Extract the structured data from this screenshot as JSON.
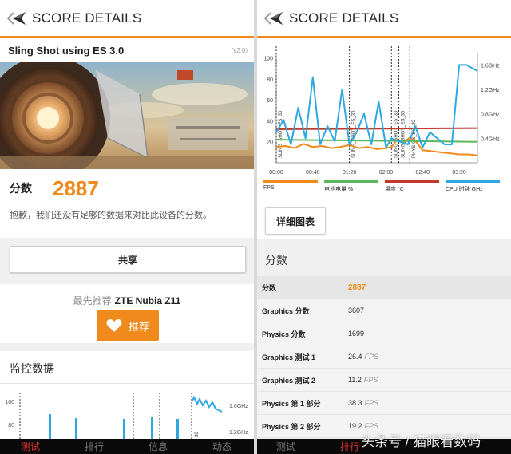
{
  "left_pane": {
    "header": {
      "title": "SCORE DETAILS"
    },
    "test": {
      "name": "Sling Shot using ES 3.0",
      "version": "(v2.0)"
    },
    "score": {
      "label": "分数",
      "value": "2887"
    },
    "notice": "抱歉，我们还没有足够的数据来对比此设备的分数。",
    "share_label": "共享",
    "recommend": {
      "prefix": "最先推荐",
      "device": "ZTE Nubia Z11",
      "button": "推荐"
    },
    "monitor": {
      "title": "监控数据",
      "y_ticks": [
        "100",
        "80"
      ],
      "right_ticks": [
        "1.6GHz",
        "1.2GHz"
      ],
      "marker_label": "30"
    }
  },
  "right_pane": {
    "header": {
      "title": "SCORE DETAILS"
    },
    "chart": {
      "legend": [
        {
          "label": "FPS",
          "color": "#f08a1c"
        },
        {
          "label": "电池电量 %",
          "color": "#5cb85c"
        },
        {
          "label": "温度 °C",
          "color": "#c0392b"
        },
        {
          "label": "CPU 时钟 GHz",
          "color": "#2ea8e0"
        }
      ]
    },
    "detail_button": "详细图表",
    "section_title": "分数",
    "table": [
      {
        "name": "分数",
        "value": "2887",
        "unit": ""
      },
      {
        "name": "Graphics 分数",
        "value": "3607",
        "unit": ""
      },
      {
        "name": "Physics 分数",
        "value": "1699",
        "unit": ""
      },
      {
        "name": "Graphics 测试 1",
        "value": "26.4",
        "unit": "FPS"
      },
      {
        "name": "Graphics 测试 2",
        "value": "11.2",
        "unit": "FPS"
      },
      {
        "name": "Physics 第 1 部分",
        "value": "38.3",
        "unit": "FPS"
      },
      {
        "name": "Physics 第 2 部分",
        "value": "19.2",
        "unit": "FPS"
      }
    ]
  },
  "bottom_nav": {
    "left": [
      {
        "label": "测试",
        "active": true
      },
      {
        "label": "排行",
        "active": false
      },
      {
        "label": "信息",
        "active": false
      },
      {
        "label": "动态",
        "active": false
      }
    ],
    "right": [
      {
        "label": "测试",
        "active": false
      },
      {
        "label": "排行",
        "active": true
      }
    ]
  },
  "watermark": "头条号 / 猫眼看数码",
  "chart_data": {
    "type": "line",
    "title": "",
    "x_ticks": [
      "00:00",
      "00:40",
      "01:20",
      "02:00",
      "02:40",
      "03:20"
    ],
    "y_ticks": [
      100,
      80,
      60,
      40,
      20
    ],
    "y2_ticks": [
      "1.6GHz",
      "1.2GHz",
      "0.8GHz",
      "0.4GHz"
    ],
    "ylim": [
      0,
      105
    ],
    "y2lim": [
      0,
      1.8
    ],
    "markers": [
      {
        "x": 0,
        "label": "SLING_SHOT_ES_30"
      },
      {
        "x": 2,
        "label": "SLING_SHOT_ES_30"
      },
      {
        "x": 3.15,
        "label": "SLING_SHOT_ES_30"
      },
      {
        "x": 3.35,
        "label": "SLING_SHOT_ES_30"
      },
      {
        "x": 3.65,
        "label": "PHYSICS_ES_30"
      }
    ],
    "series": [
      {
        "name": "FPS",
        "color": "#f08a1c",
        "x": [
          0,
          0.25,
          0.5,
          0.75,
          1.0,
          1.25,
          1.5,
          1.75,
          2.0,
          2.25,
          2.5,
          2.75,
          3.0,
          3.15,
          3.3,
          3.5,
          3.65,
          3.8,
          4.0,
          4.25,
          4.5,
          4.75,
          5.0,
          5.25,
          5.5
        ],
        "values": [
          15,
          16,
          14,
          18,
          15,
          16,
          14,
          15,
          17,
          14,
          15,
          13,
          14,
          15,
          22,
          20,
          24,
          21,
          12,
          11,
          10,
          9,
          8,
          8,
          7
        ]
      },
      {
        "name": "电池电量 %",
        "color": "#5cb85c",
        "x": [
          0,
          5.5
        ],
        "values": [
          22,
          20
        ]
      },
      {
        "name": "温度 °C",
        "color": "#c0392b",
        "x": [
          0,
          5.5
        ],
        "values": [
          32,
          33
        ]
      },
      {
        "name": "CPU 时钟 GHz",
        "color": "#2ea8e0",
        "x": [
          0,
          0.2,
          0.4,
          0.6,
          0.8,
          1.0,
          1.2,
          1.4,
          1.6,
          1.8,
          2.0,
          2.2,
          2.4,
          2.6,
          2.8,
          3.0,
          3.15,
          3.35,
          3.6,
          3.8,
          4.0,
          4.2,
          4.4,
          4.6,
          4.8,
          5.0,
          5.2,
          5.5
        ],
        "values": [
          0.5,
          0.7,
          0.3,
          0.9,
          0.4,
          1.4,
          0.3,
          0.6,
          0.35,
          1.2,
          0.3,
          0.5,
          0.8,
          0.3,
          1.0,
          0.25,
          0.4,
          0.35,
          0.3,
          0.6,
          0.25,
          0.5,
          0.4,
          0.3,
          0.3,
          1.6,
          1.6,
          1.5
        ]
      }
    ]
  }
}
